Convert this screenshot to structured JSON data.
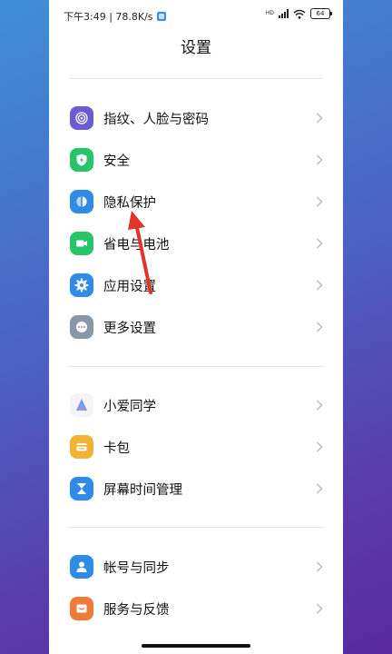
{
  "status_bar": {
    "time_speed": "下午3:49 | 78.8K/s",
    "network_label": "HD",
    "battery": "64"
  },
  "header": {
    "title": "设置"
  },
  "groups": [
    {
      "items": [
        {
          "label": "指纹、人脸与密码",
          "icon": "fingerprint-icon",
          "color": "#6a5bd6"
        },
        {
          "label": "安全",
          "icon": "shield-bolt-icon",
          "color": "#27c46b"
        },
        {
          "label": "隐私保护",
          "icon": "privacy-icon",
          "color": "#2f8be6"
        },
        {
          "label": "省电与电池",
          "icon": "battery-camera-icon",
          "color": "#27c46b"
        },
        {
          "label": "应用设置",
          "icon": "gear-icon",
          "color": "#2f8be6"
        },
        {
          "label": "更多设置",
          "icon": "more-dots-icon",
          "color": "#8a97aa"
        }
      ]
    },
    {
      "items": [
        {
          "label": "小爱同学",
          "icon": "xiaoai-icon",
          "color": "#f2f2f2"
        },
        {
          "label": "卡包",
          "icon": "card-wallet-icon",
          "color": "#f2b233"
        },
        {
          "label": "屏幕时间管理",
          "icon": "hourglass-icon",
          "color": "#2f8be6"
        }
      ]
    },
    {
      "items": [
        {
          "label": "帐号与同步",
          "icon": "account-icon",
          "color": "#2f8be6"
        },
        {
          "label": "服务与反馈",
          "icon": "feedback-icon",
          "color": "#f07a3a"
        }
      ]
    }
  ],
  "annotation": {
    "arrow_color": "#e2322b"
  }
}
